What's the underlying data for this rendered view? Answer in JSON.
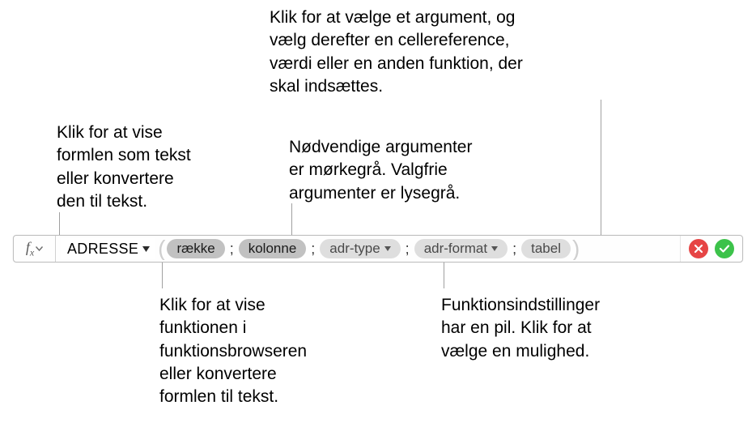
{
  "callouts": {
    "top_right": "Klik for at vælge et argument, og\nvælg derefter en cellereference,\nværdi eller en anden funktion, der\nskal indsættes.",
    "top_left": "Klik for at vise\nformlen som tekst\neller konvertere\nden til tekst.",
    "top_mid": "Nødvendige argumenter\ner mørkegrå. Valgfrie\nargumenter er lysegrå.",
    "bottom_left": "Klik for at vise\nfunktionen i\nfunktionsbrowseren\neller konvertere\nformlen til tekst.",
    "bottom_right": "Funktionsindstillinger\nhar en pil. Klik for at\nvælge en mulighed."
  },
  "formula": {
    "function_name": "ADRESSE",
    "separator": ";",
    "args": {
      "row": "række",
      "col": "kolonne",
      "adr_type": "adr-type",
      "adr_format": "adr-format",
      "table": "tabel"
    }
  },
  "icons": {
    "fx": "fx",
    "cancel": "cancel",
    "confirm": "confirm"
  }
}
